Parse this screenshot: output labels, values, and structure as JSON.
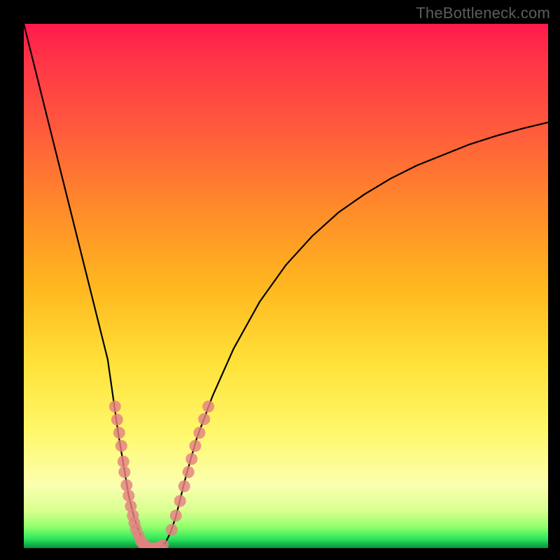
{
  "watermark": "TheBottleneck.com",
  "chart_data": {
    "type": "line",
    "title": "",
    "xlabel": "",
    "ylabel": "",
    "xlim": [
      0,
      100
    ],
    "ylim": [
      0,
      100
    ],
    "grid": false,
    "series": [
      {
        "name": "bottleneck-curve",
        "x": [
          0,
          2,
          4,
          6,
          8,
          10,
          12,
          14,
          16,
          18,
          19,
          20,
          21,
          22,
          23,
          24,
          25,
          26,
          27,
          28,
          29,
          30,
          31,
          33,
          36,
          40,
          45,
          50,
          55,
          60,
          65,
          70,
          75,
          80,
          85,
          90,
          95,
          100
        ],
        "y": [
          100,
          92,
          84,
          76,
          68,
          60,
          52,
          44,
          36,
          22,
          16,
          10,
          6,
          3,
          1,
          0.2,
          0,
          0.2,
          1,
          3,
          6,
          10,
          14,
          21,
          29,
          38,
          47,
          54,
          59.5,
          64,
          67.5,
          70.5,
          73,
          75,
          77,
          78.6,
          80,
          81.2
        ]
      }
    ],
    "markers": [
      {
        "name": "left-branch-dots",
        "x": [
          17.4,
          17.8,
          18.2,
          18.6,
          19.0,
          19.2,
          19.6,
          20.0,
          20.4,
          20.8,
          21.1,
          21.4,
          21.9,
          22.3,
          22.8
        ],
        "y": [
          27.0,
          24.5,
          22.0,
          19.5,
          16.5,
          14.5,
          12.0,
          10.0,
          8.0,
          6.2,
          4.8,
          3.6,
          2.4,
          1.4,
          0.8
        ]
      },
      {
        "name": "bottom-dots",
        "x": [
          23.4,
          24.2,
          25.0,
          25.8,
          26.5
        ],
        "y": [
          0.2,
          0.0,
          0.0,
          0.1,
          0.6
        ]
      },
      {
        "name": "right-branch-dots",
        "x": [
          28.2,
          29.0,
          29.8,
          30.6,
          31.4,
          32.0,
          32.7,
          33.5,
          34.4,
          35.2
        ],
        "y": [
          3.5,
          6.2,
          9.0,
          11.8,
          14.5,
          17.0,
          19.5,
          22.0,
          24.6,
          27.0
        ]
      }
    ],
    "colors": {
      "curve": "#000000",
      "markers": "#e58080",
      "bg_gradient_top": "#ff1a4d",
      "bg_gradient_bottom": "#0a8f3a"
    }
  }
}
